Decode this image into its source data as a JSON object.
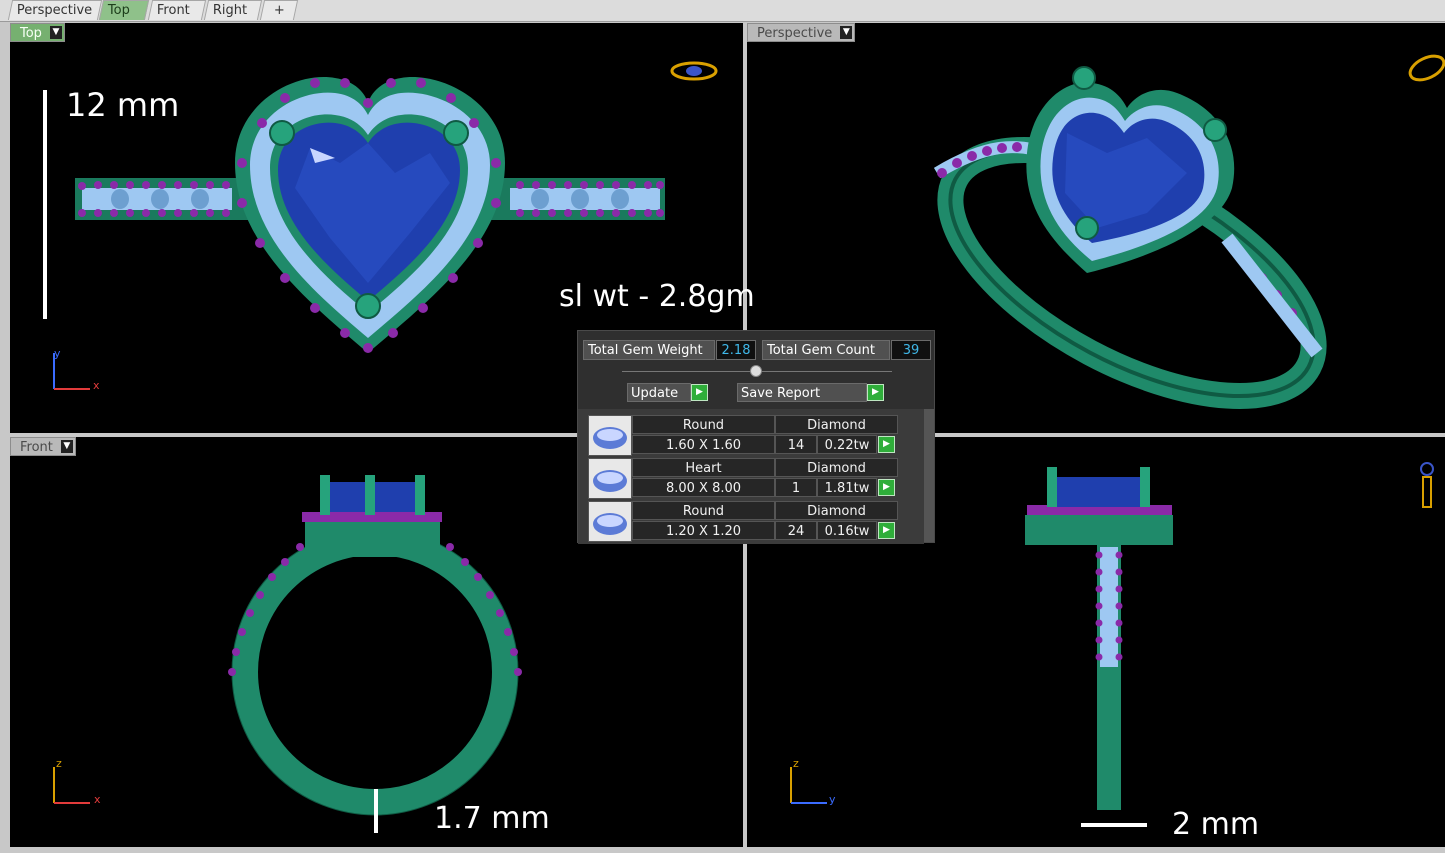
{
  "tabs": [
    {
      "label": "Perspective",
      "active": false
    },
    {
      "label": "Top",
      "active": true
    },
    {
      "label": "Front",
      "active": false
    },
    {
      "label": "Right",
      "active": false
    }
  ],
  "add_tab_icon": "plus-icon",
  "viewports": {
    "top": {
      "label": "Top",
      "axis_vertical": "y",
      "axis_horizontal": "x"
    },
    "perspective": {
      "label": "Perspective"
    },
    "front": {
      "label": "Front",
      "axis_vertical": "z",
      "axis_horizontal": "x"
    },
    "right": {
      "axis_vertical": "z",
      "axis_horizontal": "y"
    }
  },
  "annotations": {
    "height_mm": "12 mm",
    "silver_weight": "sl wt - 2.8gm",
    "band_thickness": "1.7 mm",
    "band_width": "2 mm"
  },
  "gem_panel": {
    "total_weight_label": "Total Gem Weight",
    "total_weight_value": "2.18",
    "total_count_label": "Total Gem Count",
    "total_count_value": "39",
    "update_label": "Update",
    "save_report_label": "Save Report",
    "gems": [
      {
        "shape": "Round",
        "type": "Diamond",
        "size": "1.60 X 1.60",
        "count": "14",
        "weight": "0.22tw"
      },
      {
        "shape": "Heart",
        "type": "Diamond",
        "size": "8.00 X 8.00",
        "count": "1",
        "weight": "1.81tw"
      },
      {
        "shape": "Round",
        "type": "Diamond",
        "size": "1.20 X 1.20",
        "count": "24",
        "weight": "0.16tw"
      }
    ]
  },
  "colors": {
    "metal": "#1f8a6a",
    "center_stone": "#1f3fae",
    "melee": "#9ec8f2",
    "prong": "#8a2aa8",
    "active_tab": "#8fc18a",
    "play_button": "#2fae3a",
    "value_text": "#3fb7e8"
  }
}
